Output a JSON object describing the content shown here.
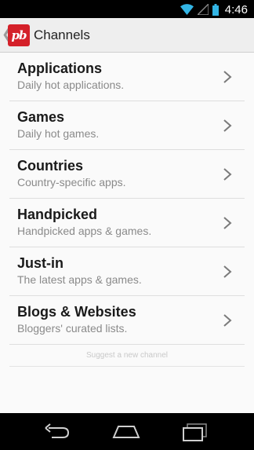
{
  "status_bar": {
    "time": "4:46",
    "icons": [
      "wifi-icon",
      "signal-icon",
      "battery-icon"
    ]
  },
  "action_bar": {
    "logo_text": "pb",
    "title": "Channels",
    "up_icon": "chevron-left-icon"
  },
  "channels": [
    {
      "name": "Applications",
      "description": "Daily hot applications."
    },
    {
      "name": "Games",
      "description": "Daily hot games."
    },
    {
      "name": "Countries",
      "description": "Country-specific apps."
    },
    {
      "name": "Handpicked",
      "description": "Handpicked apps & games."
    },
    {
      "name": "Just-in",
      "description": "The latest apps & games."
    },
    {
      "name": "Blogs & Websites",
      "description": "Bloggers' curated lists."
    }
  ],
  "suggest_link": "Suggest a new channel",
  "nav_bar": {
    "buttons": [
      "back-icon",
      "home-icon",
      "recent-apps-icon"
    ]
  },
  "colors": {
    "brand": "#d42029",
    "status_accent": "#33b5e5",
    "action_bar_bg": "#eeeeee",
    "list_bg": "#fafafa"
  }
}
